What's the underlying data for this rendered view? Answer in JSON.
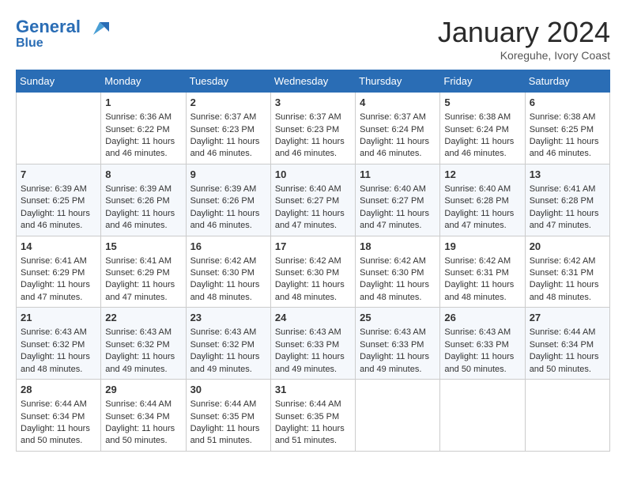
{
  "header": {
    "logo_line1": "General",
    "logo_line2": "Blue",
    "month": "January 2024",
    "location": "Koreguhe, Ivory Coast"
  },
  "weekdays": [
    "Sunday",
    "Monday",
    "Tuesday",
    "Wednesday",
    "Thursday",
    "Friday",
    "Saturday"
  ],
  "weeks": [
    [
      {
        "day": "",
        "info": ""
      },
      {
        "day": "1",
        "info": "Sunrise: 6:36 AM\nSunset: 6:22 PM\nDaylight: 11 hours\nand 46 minutes."
      },
      {
        "day": "2",
        "info": "Sunrise: 6:37 AM\nSunset: 6:23 PM\nDaylight: 11 hours\nand 46 minutes."
      },
      {
        "day": "3",
        "info": "Sunrise: 6:37 AM\nSunset: 6:23 PM\nDaylight: 11 hours\nand 46 minutes."
      },
      {
        "day": "4",
        "info": "Sunrise: 6:37 AM\nSunset: 6:24 PM\nDaylight: 11 hours\nand 46 minutes."
      },
      {
        "day": "5",
        "info": "Sunrise: 6:38 AM\nSunset: 6:24 PM\nDaylight: 11 hours\nand 46 minutes."
      },
      {
        "day": "6",
        "info": "Sunrise: 6:38 AM\nSunset: 6:25 PM\nDaylight: 11 hours\nand 46 minutes."
      }
    ],
    [
      {
        "day": "7",
        "info": "Sunrise: 6:39 AM\nSunset: 6:25 PM\nDaylight: 11 hours\nand 46 minutes."
      },
      {
        "day": "8",
        "info": "Sunrise: 6:39 AM\nSunset: 6:26 PM\nDaylight: 11 hours\nand 46 minutes."
      },
      {
        "day": "9",
        "info": "Sunrise: 6:39 AM\nSunset: 6:26 PM\nDaylight: 11 hours\nand 46 minutes."
      },
      {
        "day": "10",
        "info": "Sunrise: 6:40 AM\nSunset: 6:27 PM\nDaylight: 11 hours\nand 47 minutes."
      },
      {
        "day": "11",
        "info": "Sunrise: 6:40 AM\nSunset: 6:27 PM\nDaylight: 11 hours\nand 47 minutes."
      },
      {
        "day": "12",
        "info": "Sunrise: 6:40 AM\nSunset: 6:28 PM\nDaylight: 11 hours\nand 47 minutes."
      },
      {
        "day": "13",
        "info": "Sunrise: 6:41 AM\nSunset: 6:28 PM\nDaylight: 11 hours\nand 47 minutes."
      }
    ],
    [
      {
        "day": "14",
        "info": "Sunrise: 6:41 AM\nSunset: 6:29 PM\nDaylight: 11 hours\nand 47 minutes."
      },
      {
        "day": "15",
        "info": "Sunrise: 6:41 AM\nSunset: 6:29 PM\nDaylight: 11 hours\nand 47 minutes."
      },
      {
        "day": "16",
        "info": "Sunrise: 6:42 AM\nSunset: 6:30 PM\nDaylight: 11 hours\nand 48 minutes."
      },
      {
        "day": "17",
        "info": "Sunrise: 6:42 AM\nSunset: 6:30 PM\nDaylight: 11 hours\nand 48 minutes."
      },
      {
        "day": "18",
        "info": "Sunrise: 6:42 AM\nSunset: 6:30 PM\nDaylight: 11 hours\nand 48 minutes."
      },
      {
        "day": "19",
        "info": "Sunrise: 6:42 AM\nSunset: 6:31 PM\nDaylight: 11 hours\nand 48 minutes."
      },
      {
        "day": "20",
        "info": "Sunrise: 6:42 AM\nSunset: 6:31 PM\nDaylight: 11 hours\nand 48 minutes."
      }
    ],
    [
      {
        "day": "21",
        "info": "Sunrise: 6:43 AM\nSunset: 6:32 PM\nDaylight: 11 hours\nand 48 minutes."
      },
      {
        "day": "22",
        "info": "Sunrise: 6:43 AM\nSunset: 6:32 PM\nDaylight: 11 hours\nand 49 minutes."
      },
      {
        "day": "23",
        "info": "Sunrise: 6:43 AM\nSunset: 6:32 PM\nDaylight: 11 hours\nand 49 minutes."
      },
      {
        "day": "24",
        "info": "Sunrise: 6:43 AM\nSunset: 6:33 PM\nDaylight: 11 hours\nand 49 minutes."
      },
      {
        "day": "25",
        "info": "Sunrise: 6:43 AM\nSunset: 6:33 PM\nDaylight: 11 hours\nand 49 minutes."
      },
      {
        "day": "26",
        "info": "Sunrise: 6:43 AM\nSunset: 6:33 PM\nDaylight: 11 hours\nand 50 minutes."
      },
      {
        "day": "27",
        "info": "Sunrise: 6:44 AM\nSunset: 6:34 PM\nDaylight: 11 hours\nand 50 minutes."
      }
    ],
    [
      {
        "day": "28",
        "info": "Sunrise: 6:44 AM\nSunset: 6:34 PM\nDaylight: 11 hours\nand 50 minutes."
      },
      {
        "day": "29",
        "info": "Sunrise: 6:44 AM\nSunset: 6:34 PM\nDaylight: 11 hours\nand 50 minutes."
      },
      {
        "day": "30",
        "info": "Sunrise: 6:44 AM\nSunset: 6:35 PM\nDaylight: 11 hours\nand 51 minutes."
      },
      {
        "day": "31",
        "info": "Sunrise: 6:44 AM\nSunset: 6:35 PM\nDaylight: 11 hours\nand 51 minutes."
      },
      {
        "day": "",
        "info": ""
      },
      {
        "day": "",
        "info": ""
      },
      {
        "day": "",
        "info": ""
      }
    ]
  ]
}
